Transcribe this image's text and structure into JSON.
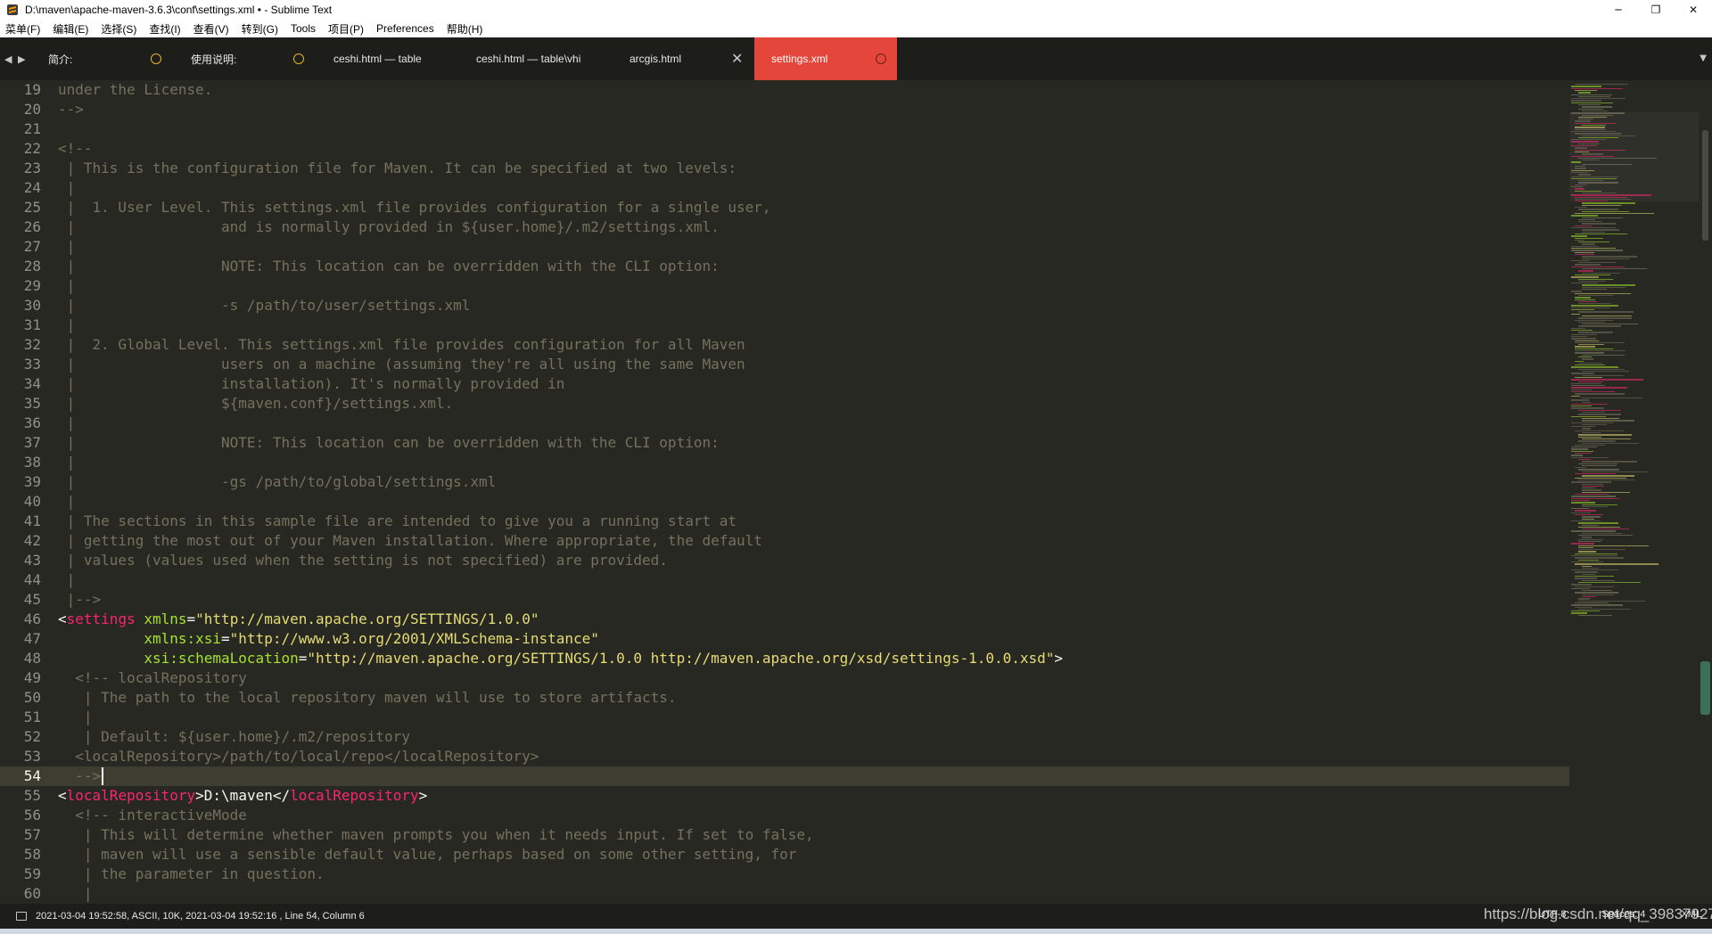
{
  "window": {
    "title": "D:\\maven\\apache-maven-3.6.3\\conf\\settings.xml • - Sublime Text",
    "minimize": "─",
    "restore": "❐",
    "close": "✕"
  },
  "menu": [
    "菜单(F)",
    "编辑(E)",
    "选择(S)",
    "查找(I)",
    "查看(V)",
    "转到(G)",
    "Tools",
    "项目(P)",
    "Preferences",
    "帮助(H)"
  ],
  "tabs": [
    {
      "label": "简介:",
      "dirty": true,
      "active": false
    },
    {
      "label": "使用说明:",
      "dirty": true,
      "active": false
    },
    {
      "label": "ceshi.html — table",
      "dirty": false,
      "active": false
    },
    {
      "label": "ceshi.html — table\\vhi",
      "dirty": false,
      "active": false
    },
    {
      "label": "arcgis.html",
      "dirty": false,
      "active": false,
      "close": "✕"
    },
    {
      "label": "settings.xml",
      "dirty": true,
      "active": true
    }
  ],
  "tab_nav": {
    "left": "◀",
    "right": "▶",
    "overflow": "▼"
  },
  "editor": {
    "current_line": 54,
    "lines": [
      {
        "n": "19",
        "t": [
          [
            "c",
            "under the License."
          ]
        ]
      },
      {
        "n": "20",
        "t": [
          [
            "c",
            "-->"
          ]
        ]
      },
      {
        "n": "21",
        "t": []
      },
      {
        "n": "22",
        "t": [
          [
            "c",
            "<!--"
          ]
        ]
      },
      {
        "n": "23",
        "t": [
          [
            "c",
            " | This is the configuration file for Maven. It can be specified at two levels:"
          ]
        ]
      },
      {
        "n": "24",
        "t": [
          [
            "c",
            " |"
          ]
        ]
      },
      {
        "n": "25",
        "t": [
          [
            "c",
            " |  1. User Level. This settings.xml file provides configuration for a single user,"
          ]
        ]
      },
      {
        "n": "26",
        "t": [
          [
            "c",
            " |                 and is normally provided in ${user.home}/.m2/settings.xml."
          ]
        ]
      },
      {
        "n": "27",
        "t": [
          [
            "c",
            " |"
          ]
        ]
      },
      {
        "n": "28",
        "t": [
          [
            "c",
            " |                 NOTE: This location can be overridden with the CLI option:"
          ]
        ]
      },
      {
        "n": "29",
        "t": [
          [
            "c",
            " |"
          ]
        ]
      },
      {
        "n": "30",
        "t": [
          [
            "c",
            " |                 -s /path/to/user/settings.xml"
          ]
        ]
      },
      {
        "n": "31",
        "t": [
          [
            "c",
            " |"
          ]
        ]
      },
      {
        "n": "32",
        "t": [
          [
            "c",
            " |  2. Global Level. This settings.xml file provides configuration for all Maven"
          ]
        ]
      },
      {
        "n": "33",
        "t": [
          [
            "c",
            " |                 users on a machine (assuming they're all using the same Maven"
          ]
        ]
      },
      {
        "n": "34",
        "t": [
          [
            "c",
            " |                 installation). It's normally provided in"
          ]
        ]
      },
      {
        "n": "35",
        "t": [
          [
            "c",
            " |                 ${maven.conf}/settings.xml."
          ]
        ]
      },
      {
        "n": "36",
        "t": [
          [
            "c",
            " |"
          ]
        ]
      },
      {
        "n": "37",
        "t": [
          [
            "c",
            " |                 NOTE: This location can be overridden with the CLI option:"
          ]
        ]
      },
      {
        "n": "38",
        "t": [
          [
            "c",
            " |"
          ]
        ]
      },
      {
        "n": "39",
        "t": [
          [
            "c",
            " |                 -gs /path/to/global/settings.xml"
          ]
        ]
      },
      {
        "n": "40",
        "t": [
          [
            "c",
            " |"
          ]
        ]
      },
      {
        "n": "41",
        "t": [
          [
            "c",
            " | The sections in this sample file are intended to give you a running start at"
          ]
        ]
      },
      {
        "n": "42",
        "t": [
          [
            "c",
            " | getting the most out of your Maven installation. Where appropriate, the default"
          ]
        ]
      },
      {
        "n": "43",
        "t": [
          [
            "c",
            " | values (values used when the setting is not specified) are provided."
          ]
        ]
      },
      {
        "n": "44",
        "t": [
          [
            "c",
            " |"
          ]
        ]
      },
      {
        "n": "45",
        "t": [
          [
            "c",
            " |-->"
          ]
        ]
      },
      {
        "n": "46",
        "t": [
          [
            "p",
            "<"
          ],
          [
            "g",
            "settings"
          ],
          [
            "p",
            " "
          ],
          [
            "a",
            "xmlns"
          ],
          [
            "p",
            "="
          ],
          [
            "s",
            "\"http://maven.apache.org/SETTINGS/1.0.0\""
          ]
        ]
      },
      {
        "n": "47",
        "t": [
          [
            "p",
            "          "
          ],
          [
            "a",
            "xmlns:xsi"
          ],
          [
            "p",
            "="
          ],
          [
            "s",
            "\"http://www.w3.org/2001/XMLSchema-instance\""
          ]
        ]
      },
      {
        "n": "48",
        "t": [
          [
            "p",
            "          "
          ],
          [
            "a",
            "xsi:schemaLocation"
          ],
          [
            "p",
            "="
          ],
          [
            "s",
            "\"http://maven.apache.org/SETTINGS/1.0.0 http://maven.apache.org/xsd/settings-1.0.0.xsd\""
          ],
          [
            "p",
            ">"
          ]
        ]
      },
      {
        "n": "49",
        "t": [
          [
            "c",
            "  <!-- localRepository"
          ]
        ]
      },
      {
        "n": "50",
        "t": [
          [
            "c",
            "   | The path to the local repository maven will use to store artifacts."
          ]
        ]
      },
      {
        "n": "51",
        "t": [
          [
            "c",
            "   |"
          ]
        ]
      },
      {
        "n": "52",
        "t": [
          [
            "c",
            "   | Default: ${user.home}/.m2/repository"
          ]
        ]
      },
      {
        "n": "53",
        "t": [
          [
            "c",
            "  <localRepository>/path/to/local/repo</localRepository>"
          ]
        ]
      },
      {
        "n": "54",
        "t": [
          [
            "c",
            "  -->"
          ]
        ]
      },
      {
        "n": "55",
        "t": [
          [
            "p",
            "<"
          ],
          [
            "g",
            "localRepository"
          ],
          [
            "p",
            ">"
          ],
          [
            "x",
            "D:\\maven"
          ],
          [
            "p",
            "</"
          ],
          [
            "g",
            "localRepository"
          ],
          [
            "p",
            ">"
          ]
        ]
      },
      {
        "n": "56",
        "t": [
          [
            "c",
            "  <!-- interactiveMode"
          ]
        ]
      },
      {
        "n": "57",
        "t": [
          [
            "c",
            "   | This will determine whether maven prompts you when it needs input. If set to false,"
          ]
        ]
      },
      {
        "n": "58",
        "t": [
          [
            "c",
            "   | maven will use a sensible default value, perhaps based on some other setting, for"
          ]
        ]
      },
      {
        "n": "59",
        "t": [
          [
            "c",
            "   | the parameter in question."
          ]
        ]
      },
      {
        "n": "60",
        "t": [
          [
            "c",
            "   |"
          ]
        ]
      }
    ]
  },
  "status": {
    "left": "2021-03-04 19:52:58, ASCII, 10K, 2021-03-04 19:52:16 , Line 54, Column 6",
    "encoding": "UTF-8",
    "indent": "Spaces: 4",
    "syntax": "XML"
  },
  "watermark": "https://blog.csdn.net/qq_39837927",
  "colors": {
    "background": "#272822",
    "comment": "#75715e",
    "tag": "#f92672",
    "attribute": "#a6e22e",
    "string": "#e6db74",
    "active_tab": "#e5463b"
  }
}
